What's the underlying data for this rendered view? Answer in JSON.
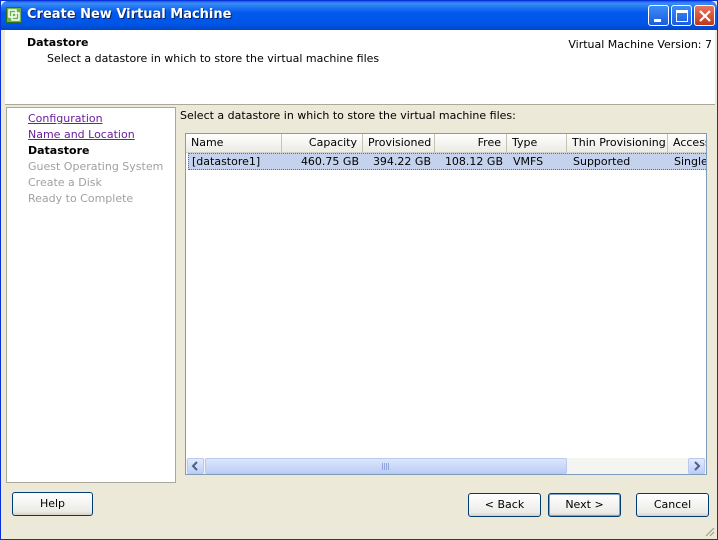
{
  "window": {
    "title": "Create New Virtual Machine",
    "controls": [
      "minimize-icon",
      "maximize-icon",
      "close-icon"
    ]
  },
  "header": {
    "title": "Datastore",
    "subtitle": "Select a datastore in which to store the virtual machine files",
    "version": "Virtual Machine Version: 7"
  },
  "steps": [
    {
      "label": "Configuration",
      "state": "link"
    },
    {
      "label": "Name and Location",
      "state": "link"
    },
    {
      "label": "Datastore",
      "state": "current"
    },
    {
      "label": "Guest Operating System",
      "state": "disabled"
    },
    {
      "label": "Create a Disk",
      "state": "disabled"
    },
    {
      "label": "Ready to Complete",
      "state": "disabled"
    }
  ],
  "main": {
    "instruction": "Select a datastore in which to store the virtual machine files:"
  },
  "table": {
    "columns": [
      "Name",
      "Capacity",
      "Provisioned",
      "Free",
      "Type",
      "Thin Provisioning",
      "Access"
    ],
    "rows": [
      [
        "[datastore1]",
        "460.75 GB",
        "394.22 GB",
        "108.12 GB",
        "VMFS",
        "Supported",
        "Single host"
      ]
    ]
  },
  "buttons": {
    "help": "Help",
    "back": "< Back",
    "next": "Next >",
    "cancel": "Cancel"
  },
  "colors": {
    "titlebar": "#0055E5",
    "selected_row": "#C4D2EE",
    "link": "#6B1E9C"
  }
}
